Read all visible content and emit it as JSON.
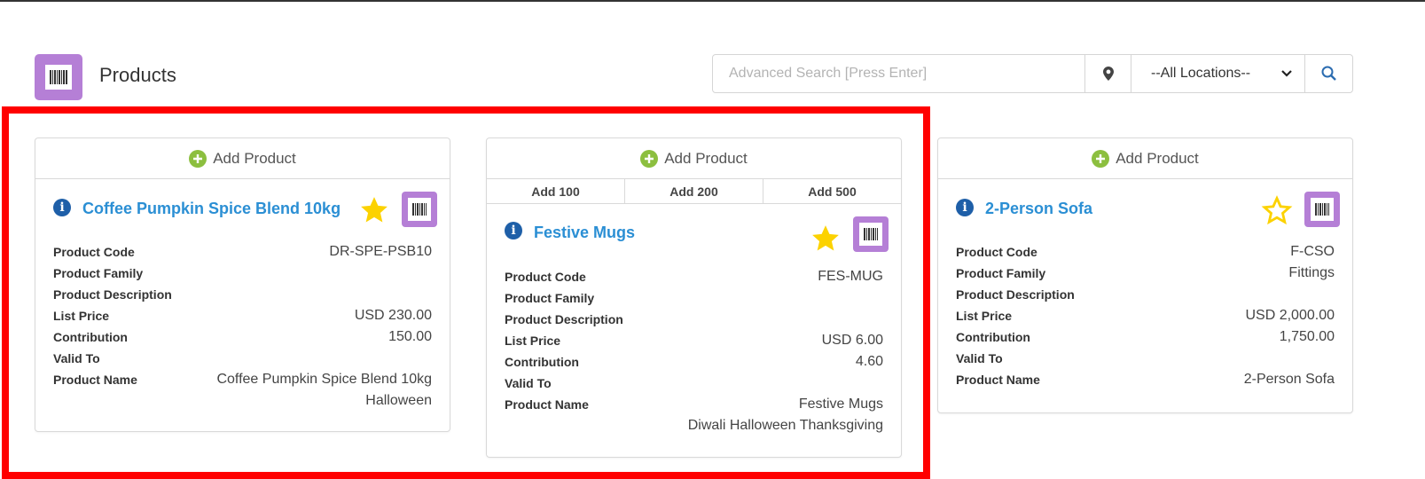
{
  "header": {
    "title": "Products",
    "icon": "barcode-icon",
    "accent_color": "#b57fd6"
  },
  "search": {
    "placeholder": "Advanced Search [Press Enter]",
    "location_selected": "--All Locations--"
  },
  "highlight_color": "#ff0000",
  "cards": [
    {
      "add_label": "Add Product",
      "quick_add": [],
      "name": "Coffee Pumpkin Spice Blend 10kg",
      "favorite": true,
      "fields": {
        "code_label": "Product Code",
        "code": "DR-SPE-PSB10",
        "family_label": "Product Family",
        "family": "",
        "desc_label": "Product Description",
        "desc": "",
        "price_label": "List Price",
        "price": "USD 230.00",
        "contrib_label": "Contribution",
        "contrib": "150.00",
        "valid_label": "Valid To",
        "valid": "",
        "pname_label": "Product Name",
        "pname": "Coffee Pumpkin Spice Blend 10kg",
        "tags": "Halloween"
      }
    },
    {
      "add_label": "Add Product",
      "quick_add": [
        "Add 100",
        "Add 200",
        "Add 500"
      ],
      "name": "Festive Mugs",
      "favorite": true,
      "fields": {
        "code_label": "Product Code",
        "code": "FES-MUG",
        "family_label": "Product Family",
        "family": "",
        "desc_label": "Product Description",
        "desc": "",
        "price_label": "List Price",
        "price": "USD 6.00",
        "contrib_label": "Contribution",
        "contrib": "4.60",
        "valid_label": "Valid To",
        "valid": "",
        "pname_label": "Product Name",
        "pname": "Festive Mugs",
        "tags": "Diwali Halloween Thanksgiving"
      }
    },
    {
      "add_label": "Add Product",
      "quick_add": [],
      "name": "2-Person Sofa",
      "favorite": false,
      "fields": {
        "code_label": "Product Code",
        "code": "F-CSO",
        "family_label": "Product Family",
        "family": "Fittings",
        "desc_label": "Product Description",
        "desc": "",
        "price_label": "List Price",
        "price": "USD 2,000.00",
        "contrib_label": "Contribution",
        "contrib": "1,750.00",
        "valid_label": "Valid To",
        "valid": "",
        "pname_label": "Product Name",
        "pname": "2-Person Sofa",
        "tags": ""
      }
    }
  ]
}
